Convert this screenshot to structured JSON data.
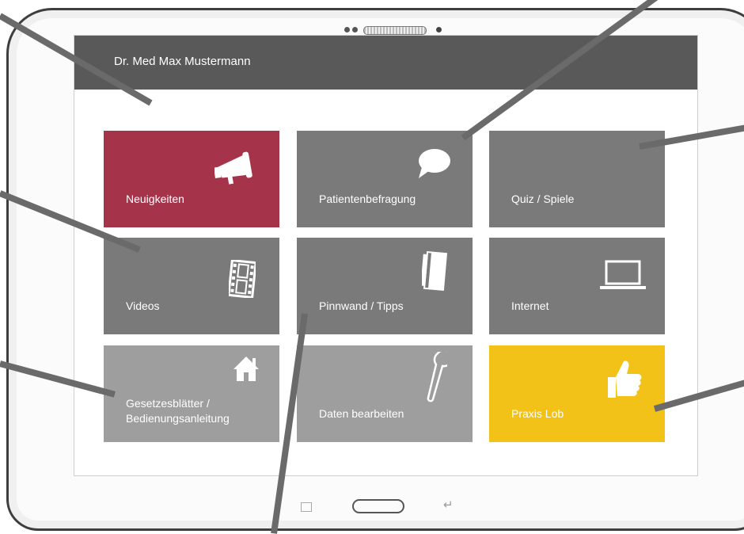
{
  "app": {
    "title": "Dr. Med Max Mustermann"
  },
  "tiles": [
    {
      "label": "Neuigkeiten",
      "icon": "megaphone-icon",
      "color": "#a5344a"
    },
    {
      "label": "Patientenbefragung",
      "icon": "speech-bubble-icon",
      "color": "#7a7a7a"
    },
    {
      "label": "Quiz / Spiele",
      "icon": "",
      "color": "#7a7a7a"
    },
    {
      "label": "Videos",
      "icon": "film-icon",
      "color": "#7a7a7a"
    },
    {
      "label": "Pinnwand / Tipps",
      "icon": "notebook-icon",
      "color": "#7a7a7a"
    },
    {
      "label": "Internet",
      "icon": "laptop-icon",
      "color": "#7a7a7a"
    },
    {
      "label": "Gesetzesblätter /",
      "label2": "Bedienungsanleitung",
      "icon": "home-icon",
      "color": "#9e9e9e"
    },
    {
      "label": "Daten bearbeiten",
      "icon": "wrench-icon",
      "color": "#9e9e9e"
    },
    {
      "label": "Praxis Lob",
      "icon": "thumbs-up-icon",
      "color": "#f2c218"
    }
  ],
  "navbar": {
    "back_icon": "back-arrow-icon",
    "home_icon": "home-button-icon",
    "recent_icon": "recent-apps-icon"
  }
}
